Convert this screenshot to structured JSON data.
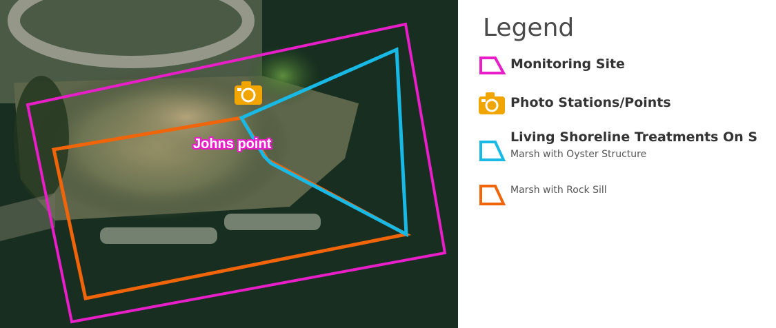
{
  "map": {
    "label": "Johns point",
    "colors": {
      "monitoring_site": "#e81ec8",
      "oyster": "#19b9e6",
      "rock_sill": "#f0640a",
      "camera": "#f0a500"
    }
  },
  "legend": {
    "title": "Legend",
    "items": [
      {
        "label": "Monitoring Site",
        "icon": "polygon-magenta-icon"
      },
      {
        "label": "Photo Stations/Points",
        "icon": "camera-icon"
      },
      {
        "label": "Living Shoreline Treatments On S",
        "sublabel": "Marsh with Oyster Structure",
        "icon": "polygon-cyan-icon"
      },
      {
        "sublabel": "Marsh with Rock Sill",
        "icon": "polygon-orange-icon"
      }
    ]
  }
}
